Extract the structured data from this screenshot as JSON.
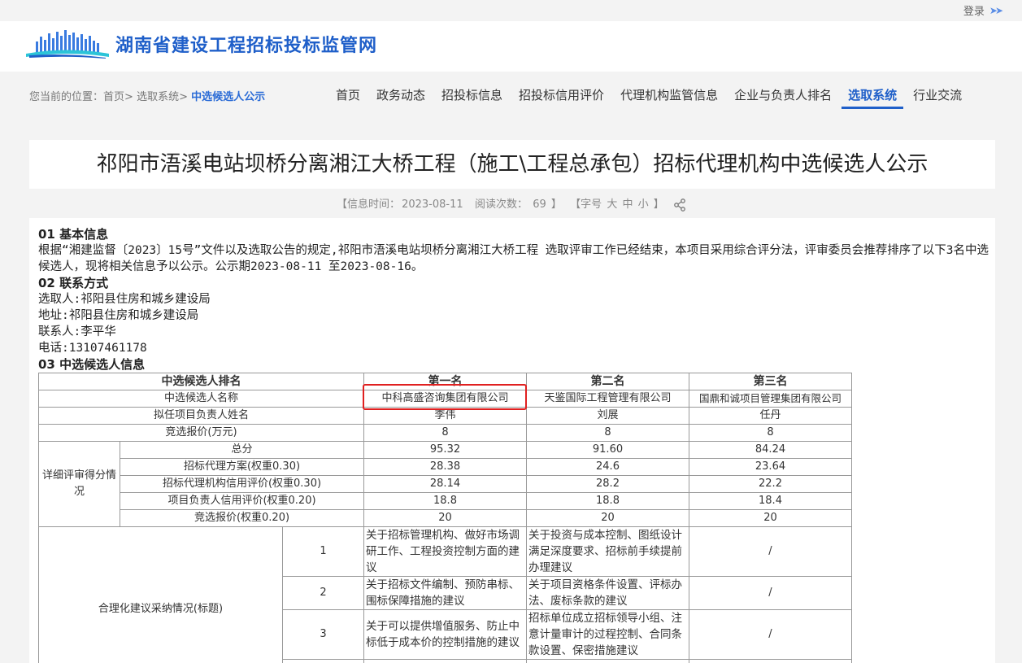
{
  "topbar": {
    "login_label": "登录"
  },
  "header": {
    "site_title": "湖南省建设工程招标投标监管网"
  },
  "breadcrumb": {
    "prefix": "您当前的位置：",
    "home": "首页",
    "sep1": ">",
    "section": "选取系统",
    "sep2": ">",
    "current": "中选候选人公示"
  },
  "nav": {
    "items": [
      {
        "label": "首页"
      },
      {
        "label": "政务动态"
      },
      {
        "label": "招投标信息"
      },
      {
        "label": "招投标信用评价"
      },
      {
        "label": "代理机构监管信息"
      },
      {
        "label": "企业与负责人排名"
      },
      {
        "label": "选取系统"
      },
      {
        "label": "行业交流"
      }
    ],
    "active_index": 6
  },
  "article": {
    "title": "祁阳市浯溪电站坝桥分离湘江大桥工程（施工\\工程总承包）招标代理机构中选候选人公示",
    "info": {
      "open": "【信息时间：",
      "date": "2023-08-11",
      "read_label": "阅读次数：",
      "read_count": "69",
      "close": "】",
      "font_open": "【字号",
      "font_large": "大",
      "font_medium": "中",
      "font_small": "小",
      "font_close": "】"
    },
    "sections": {
      "s1_title": "01 基本信息",
      "s1_text": "根据“湘建监督〔2023〕15号”文件以及选取公告的规定,祁阳市浯溪电站坝桥分离湘江大桥工程 选取评审工作已经结束，本项目采用综合评分法，评审委员会推荐排序了以下3名中选候选人，现将相关信息予以公示。公示期2023-08-11 至2023-08-16。",
      "s2_title": "02 联系方式",
      "contact_org": "选取人:祁阳县住房和城乡建设局",
      "contact_addr": "地址:祁阳县住房和城乡建设局",
      "contact_person": "联系人:李平华",
      "contact_phone": "电话:13107461178",
      "s3_title": "03 中选候选人信息"
    },
    "table": {
      "rank_label": "中选候选人排名",
      "ranks": [
        "第一名",
        "第二名",
        "第三名"
      ],
      "name_label": "中选候选人名称",
      "names": [
        "中科高盛咨询集团有限公司",
        "天鉴国际工程管理有限公司",
        "国鼎和诚项目管理集团有限公司"
      ],
      "leader_label": "拟任项目负责人姓名",
      "leaders": [
        "李伟",
        "刘展",
        "任丹"
      ],
      "price_label": "竞选报价(万元)",
      "prices": [
        "8",
        "8",
        "8"
      ],
      "detail_label": "详细评审得分情况",
      "total_label": "总分",
      "totals": [
        "95.32",
        "91.60",
        "84.24"
      ],
      "plan_label": "招标代理方案(权重0.30)",
      "plans": [
        "28.38",
        "24.6",
        "23.64"
      ],
      "credit_label": "招标代理机构信用评价(权重0.30)",
      "credits": [
        "28.14",
        "28.2",
        "22.2"
      ],
      "leader_credit_label": "项目负责人信用评价(权重0.20)",
      "leader_credits": [
        "18.8",
        "18.8",
        "18.4"
      ],
      "bid_label": "竞选报价(权重0.20)",
      "bids": [
        "20",
        "20",
        "20"
      ],
      "rational_label": "合理化建议采纳情况(标题)",
      "suggestions": [
        {
          "no": "1",
          "c1": "关于招标管理机构、做好市场调研工作、工程投资控制方面的建议",
          "c2": "关于投资与成本控制、图纸设计满足深度要求、招标前手续提前办理建议",
          "c3": "/"
        },
        {
          "no": "2",
          "c1": "关于招标文件编制、预防串标、围标保障措施的建议",
          "c2": "关于项目资格条件设置、评标办法、废标条款的建议",
          "c3": "/"
        },
        {
          "no": "3",
          "c1": "关于可以提供增值服务、防止中标低于成本价的控制措施的建议",
          "c2": "招标单位成立招标领导小组、注意计量审计的过程控制、合同条款设置、保密措施建议",
          "c3": "/"
        }
      ]
    }
  },
  "colors": {
    "brand": "#1f5fc9",
    "highlight": "#e02020"
  }
}
